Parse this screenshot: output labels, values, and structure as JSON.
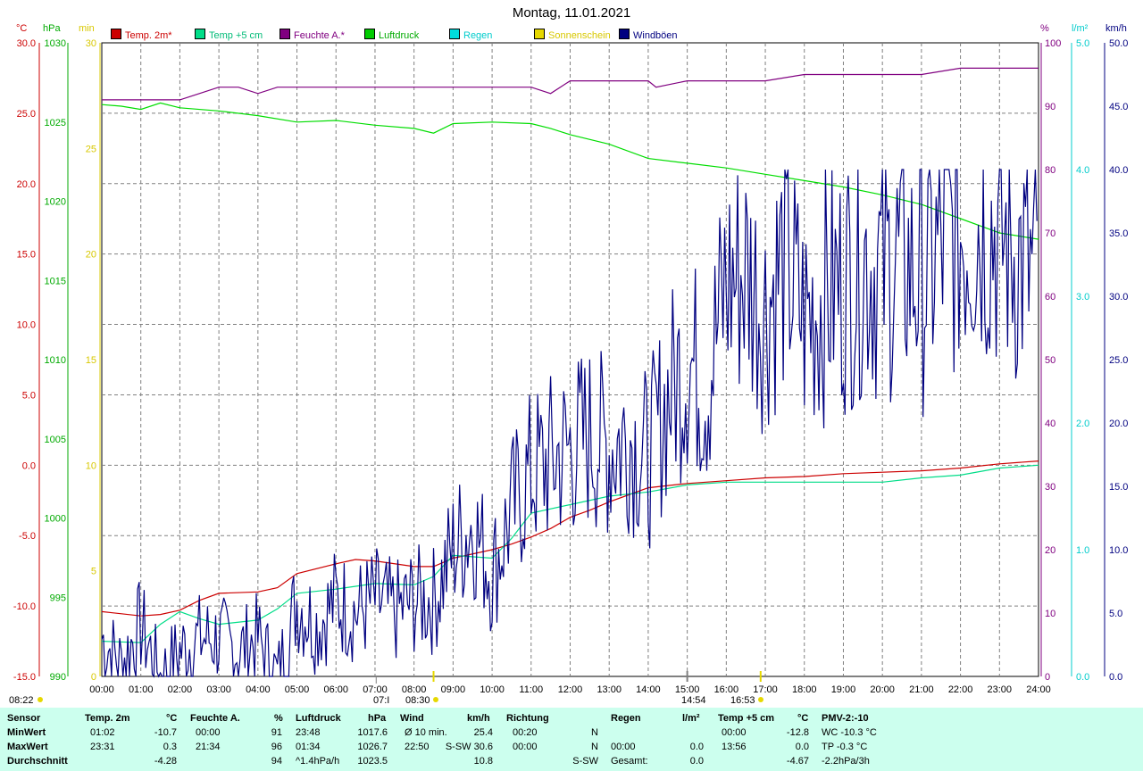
{
  "title": "Montag, 11.01.2021",
  "units": {
    "temp": "°C",
    "pressure": "hPa",
    "sun": "min",
    "humidity": "%",
    "rain": "l/m²",
    "wind": "km/h"
  },
  "legend": [
    {
      "label": "Temp. 2m*",
      "color": "#cc0000"
    },
    {
      "label": "Temp +5 cm",
      "color": "#00dd88"
    },
    {
      "label": "Feuchte A.*",
      "color": "#800080"
    },
    {
      "label": "Luftdruck",
      "color": "#00cc00"
    },
    {
      "label": "Regen",
      "color": "#00dddd"
    },
    {
      "label": "Sonnenschein",
      "color": "#e6d800"
    },
    {
      "label": "Windböen",
      "color": "#000080"
    }
  ],
  "axes": {
    "temp": [
      "30.0",
      "25.0",
      "20.0",
      "15.0",
      "10.0",
      "5.0",
      "0.0",
      "-5.0",
      "-10.0",
      "-15.0"
    ],
    "pressure": [
      "1030",
      "1025",
      "1020",
      "1015",
      "1010",
      "1005",
      "1000",
      "995",
      "990"
    ],
    "sun": [
      "30",
      "25",
      "20",
      "15",
      "10",
      "5",
      "0"
    ],
    "humidity": [
      "100",
      "90",
      "80",
      "70",
      "60",
      "50",
      "40",
      "30",
      "20",
      "10",
      "0"
    ],
    "rain": [
      "5.0",
      "4.0",
      "3.0",
      "2.0",
      "1.0",
      "0.0"
    ],
    "wind": [
      "50.0",
      "45.0",
      "40.0",
      "35.0",
      "30.0",
      "25.0",
      "20.0",
      "15.0",
      "10.0",
      "5.0",
      "0.0"
    ],
    "time": [
      "00:00",
      "01:00",
      "02:00",
      "03:00",
      "04:00",
      "05:00",
      "06:00",
      "07:00",
      "08:00",
      "09:00",
      "10:00",
      "11:00",
      "12:00",
      "13:00",
      "14:00",
      "15:00",
      "16:00",
      "17:00",
      "18:00",
      "19:00",
      "20:00",
      "21:00",
      "22:00",
      "23:00",
      "24:00"
    ]
  },
  "markers": {
    "sunrise": "08:22",
    "m1": "07:I",
    "m2": "08:30",
    "m3": "14:54",
    "m4": "16:53"
  },
  "chart_data": {
    "type": "line",
    "title": "Montag, 11.01.2021",
    "x_range": [
      "00:00",
      "24:00"
    ],
    "series": [
      {
        "name": "Temp. 2m*",
        "unit": "°C",
        "x": [
          0,
          1,
          1.5,
          2,
          2.5,
          3,
          4,
          4.5,
          5,
          6,
          6.5,
          7,
          8,
          8.5,
          9,
          10,
          10.5,
          11,
          11.5,
          12,
          12.5,
          13,
          13.5,
          14,
          15,
          16,
          17,
          18,
          19,
          20,
          21,
          22,
          23,
          24
        ],
        "y": [
          -10.4,
          -10.7,
          -10.6,
          -10.3,
          -9.6,
          -9.1,
          -9.0,
          -8.7,
          -7.7,
          -7.0,
          -6.7,
          -6.8,
          -7.2,
          -7.2,
          -6.6,
          -6.0,
          -5.6,
          -5.1,
          -4.5,
          -3.7,
          -3.2,
          -2.6,
          -2.1,
          -1.6,
          -1.3,
          -1.1,
          -0.9,
          -0.8,
          -0.6,
          -0.5,
          -0.4,
          -0.2,
          0.1,
          0.3
        ]
      },
      {
        "name": "Temp +5 cm",
        "unit": "°C",
        "x": [
          0,
          1,
          1.5,
          2,
          2.5,
          3,
          4,
          4.5,
          5,
          6,
          7,
          8,
          8.5,
          9,
          10,
          10.5,
          11,
          12,
          13,
          14,
          15,
          16,
          17,
          18,
          19,
          20,
          21,
          22,
          23,
          24
        ],
        "y": [
          -12.5,
          -12.6,
          -11.3,
          -10.4,
          -10.9,
          -11.3,
          -11.0,
          -10.2,
          -9.1,
          -8.8,
          -8.4,
          -8.5,
          -7.9,
          -6.4,
          -6.6,
          -5.2,
          -3.4,
          -2.8,
          -2.2,
          -1.9,
          -1.4,
          -1.2,
          -1.2,
          -1.2,
          -1.2,
          -1.2,
          -0.9,
          -0.7,
          -0.2,
          0.0
        ]
      },
      {
        "name": "Feuchte A.*",
        "unit": "%",
        "x": [
          0,
          1,
          2,
          2.5,
          3,
          3.5,
          4,
          4.5,
          5,
          6,
          7,
          8,
          9,
          10,
          11,
          11.5,
          12,
          13,
          14,
          14.2,
          15,
          16,
          17,
          18,
          19,
          20,
          21,
          22,
          22.5,
          23,
          24
        ],
        "y": [
          91,
          91,
          91,
          92,
          93,
          93,
          92,
          93,
          93,
          93,
          93,
          93,
          93,
          93,
          93,
          92,
          94,
          94,
          94,
          93,
          94,
          94,
          94,
          95,
          95,
          95,
          95,
          96,
          96,
          96,
          96
        ]
      },
      {
        "name": "Luftdruck",
        "unit": "hPa",
        "x": [
          0,
          0.5,
          1,
          1.5,
          2,
          3,
          4,
          5,
          6,
          7,
          8,
          8.5,
          9,
          10,
          11,
          11.5,
          12,
          13,
          14,
          15,
          16,
          17,
          18,
          19,
          20,
          21,
          22,
          23,
          24
        ],
        "y": [
          1026.1,
          1026.0,
          1025.8,
          1026.2,
          1025.9,
          1025.7,
          1025.4,
          1025.0,
          1025.1,
          1024.8,
          1024.6,
          1024.3,
          1024.9,
          1025.0,
          1024.9,
          1024.6,
          1024.2,
          1023.6,
          1022.7,
          1022.4,
          1022.1,
          1021.7,
          1021.3,
          1020.9,
          1020.4,
          1019.8,
          1018.9,
          1018.0,
          1017.6
        ]
      },
      {
        "name": "Windböen",
        "unit": "km/h",
        "x": [
          0,
          0.5,
          1,
          1.5,
          2,
          2.5,
          3,
          3.5,
          4,
          4.5,
          5,
          5.5,
          6,
          6.5,
          7,
          7.5,
          8,
          8.5,
          9,
          9.5,
          10,
          10.5,
          11,
          11.5,
          12,
          12.5,
          13,
          13.5,
          14,
          14.5,
          15,
          15.5,
          16,
          16.5,
          17,
          17.5,
          18,
          18.5,
          19,
          19.5,
          20,
          20.5,
          21,
          21.5,
          22,
          22.5,
          23,
          23.5,
          24
        ],
        "y": [
          3,
          1,
          4,
          0,
          2,
          3,
          3,
          2,
          3,
          0,
          6,
          4,
          6,
          5,
          6,
          5,
          6,
          6,
          10,
          12,
          8,
          13,
          16,
          17,
          18,
          19,
          18,
          19,
          17,
          22,
          25,
          23,
          31,
          32,
          29,
          33,
          28,
          30,
          31,
          33,
          32,
          33,
          31,
          34,
          35,
          36,
          35,
          33,
          31
        ]
      }
    ],
    "stats": {
      "headers": {
        "sensor": "Sensor",
        "temp2m": "Temp. 2m",
        "temp2m_unit": "°C",
        "humidity": "Feuchte A.",
        "humidity_unit": "%",
        "pressure": "Luftdruck",
        "pressure_unit": "hPa",
        "wind": "Wind",
        "wind_unit": "km/h",
        "direction": "Richtung",
        "rain": "Regen",
        "rain_unit": "l/m²",
        "temp5": "Temp +5 cm",
        "temp5_unit": "°C",
        "pmv": "PMV-2:-10"
      },
      "rows": [
        {
          "label": "MinWert",
          "t2_time": "01:02",
          "t2_val": "-10.7",
          "h_time": "00:00",
          "h_val": "91",
          "p_time": "23:48",
          "p_val": "1017.6",
          "w_time": "Ø 10 min.",
          "w_val": "25.4",
          "d_time": "00:20",
          "d_val": "N",
          "r_time": "",
          "r_val": "",
          "t5_time": "00:00",
          "t5_val": "-12.8",
          "pmv": "WC -10.3 °C"
        },
        {
          "label": "MaxWert",
          "t2_time": "23:31",
          "t2_val": "0.3",
          "h_time": "21:34",
          "h_val": "96",
          "p_time": "01:34",
          "p_val": "1026.7",
          "w_time": "22:50",
          "w_val": "S-SW 30.6",
          "d_time": "00:00",
          "d_val": "N",
          "r_time": "00:00",
          "r_val": "0.0",
          "t5_time": "13:56",
          "t5_val": "0.0",
          "pmv": "TP -0.3 °C"
        },
        {
          "label": "Durchschnitt",
          "t2_time": "",
          "t2_val": "-4.28",
          "h_time": "",
          "h_val": "94",
          "p_time": "^1.4hPa/h",
          "p_val": "1023.5",
          "w_time": "",
          "w_val": "10.8",
          "d_time": "",
          "d_val": "S-SW",
          "r_time": "Gesamt:",
          "r_val": "0.0",
          "t5_time": "",
          "t5_val": "-4.67",
          "pmv": "-2.2hPa/3h"
        }
      ]
    }
  }
}
